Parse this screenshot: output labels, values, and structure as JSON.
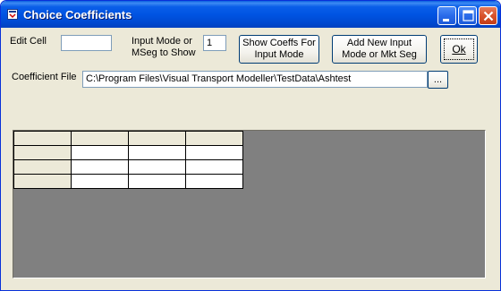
{
  "window": {
    "title": "Choice Coefficients",
    "icons": [
      "app-icon",
      "minimize-icon",
      "maximize-icon",
      "close-icon"
    ]
  },
  "form": {
    "edit_cell_label": "Edit Cell",
    "edit_cell_value": "",
    "input_mode_label_line1": "Input Mode or",
    "input_mode_label_line2": "MSeg to Show",
    "input_mode_value": "1",
    "show_coeffs_line1": "Show Coeffs For",
    "show_coeffs_line2": "Input Mode",
    "add_new_line1": "Add New Input",
    "add_new_line2": "Mode or Mkt Seg",
    "ok_label": "Ok",
    "coefficient_file_label": "Coefficient File",
    "coefficient_file_value": "C:\\Program Files\\Visual Transport Modeller\\TestData\\Ashtest",
    "browse_label": "..."
  },
  "grid": {
    "rows": 4,
    "cols": 4,
    "cells": [
      [
        "",
        "",
        "",
        ""
      ],
      [
        "",
        "",
        "",
        ""
      ],
      [
        "",
        "",
        "",
        ""
      ],
      [
        "",
        "",
        "",
        ""
      ]
    ]
  },
  "colors": {
    "titlebar": "#0054e3",
    "face": "#ece9d8",
    "grid_background": "#808080"
  }
}
